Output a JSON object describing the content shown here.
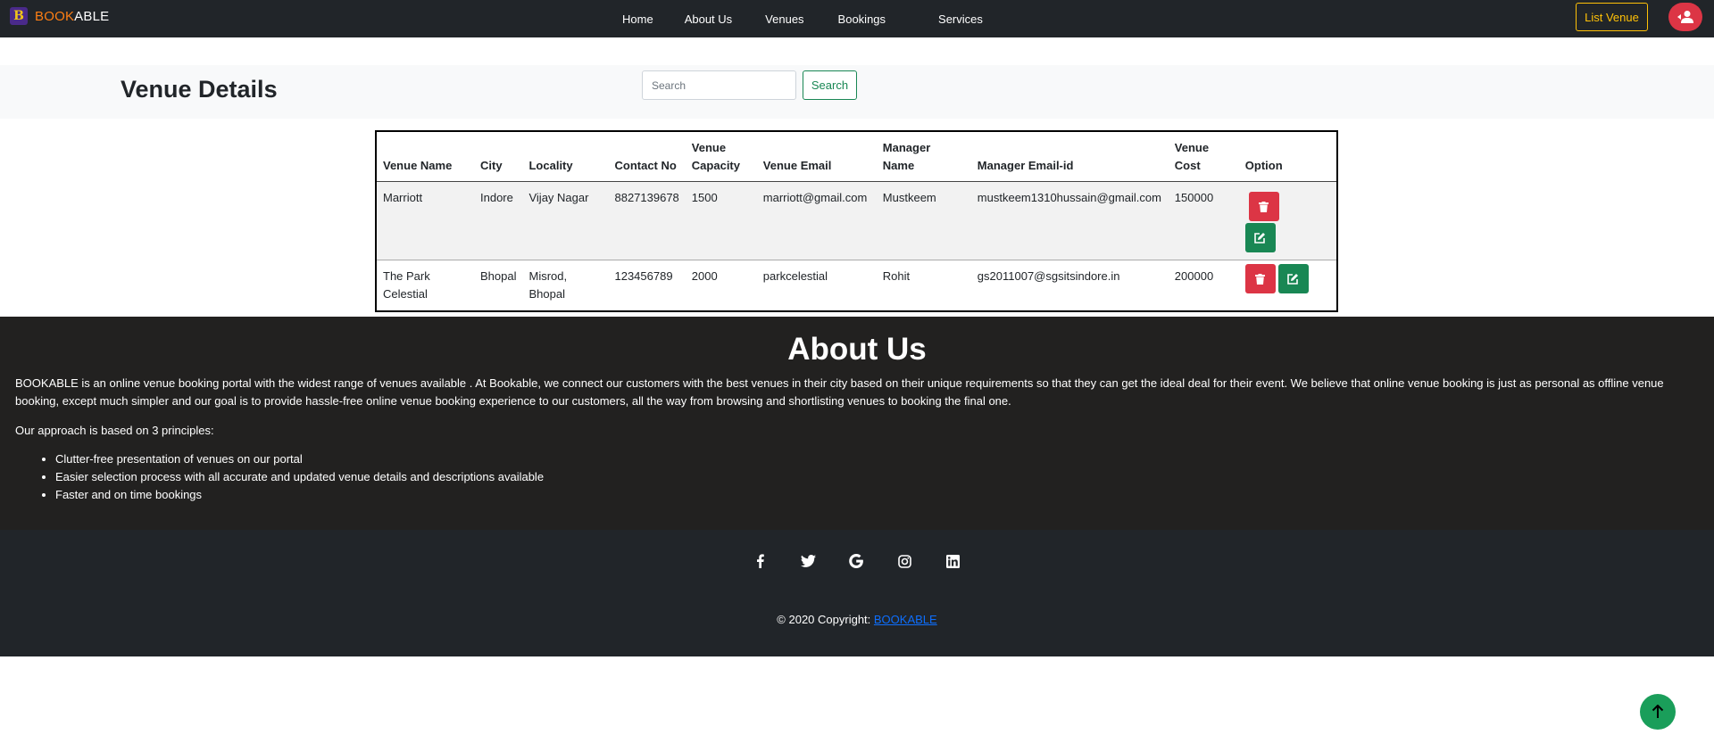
{
  "nav": {
    "brand_part1": "BOOK",
    "brand_part2": "ABLE",
    "brand_logo_letter": "B",
    "links": [
      "Home",
      "About Us",
      "Venues",
      "Bookings",
      "Services"
    ],
    "list_venue": "List Venue",
    "user_icon": "user-logout-icon"
  },
  "header": {
    "title": "Venue Details",
    "search_placeholder": "Search",
    "search_button": "Search"
  },
  "table": {
    "headers": [
      "Venue Name",
      "City",
      "Locality",
      "Contact No",
      "Venue Capacity",
      "Venue Email",
      "Manager Name",
      "Manager Email-id",
      "Venue Cost",
      "Option"
    ],
    "rows": [
      [
        "Marriott",
        "Indore",
        "Vijay Nagar",
        "8827139678",
        "1500",
        "marriott@gmail.com",
        "Mustkeem",
        "mustkeem1310hussain@gmail.com",
        "150000"
      ],
      [
        "The Park Celestial",
        "Bhopal",
        "Misrod, Bhopal",
        "123456789",
        "2000",
        "parkcelestial",
        "Rohit",
        "gs2011007@sgsitsindore.in",
        "200000"
      ]
    ]
  },
  "about": {
    "title": "About Us",
    "paragraph": "BOOKABLE is an online venue booking portal with the widest range of venues available . At Bookable, we connect our customers with the best venues in their city based on their unique requirements so that they can get the ideal deal for their event. We believe that online venue booking is just as personal as offline venue booking, except much simpler and our goal is to provide hassle-free online venue booking experience to our customers, all the way from browsing and shortlisting venues to booking the final one.",
    "approach": "Our approach is based on 3 principles:",
    "principles": [
      "Clutter-free presentation of venues on our portal",
      "Easier selection process with all accurate and updated venue details and descriptions available",
      "Faster and on time bookings"
    ]
  },
  "footer": {
    "social_icons": [
      "facebook-icon",
      "twitter-icon",
      "google-icon",
      "instagram-icon",
      "linkedin-icon"
    ],
    "copyright_text": "© 2020 Copyright: ",
    "copyright_link": "BOOKABLE"
  },
  "colors": {
    "navbar": "#212529",
    "brand_orange": "#fd7e14",
    "accent_yellow": "#ffc107",
    "danger": "#dc3545",
    "success": "#198754",
    "about_bg": "#222120"
  }
}
